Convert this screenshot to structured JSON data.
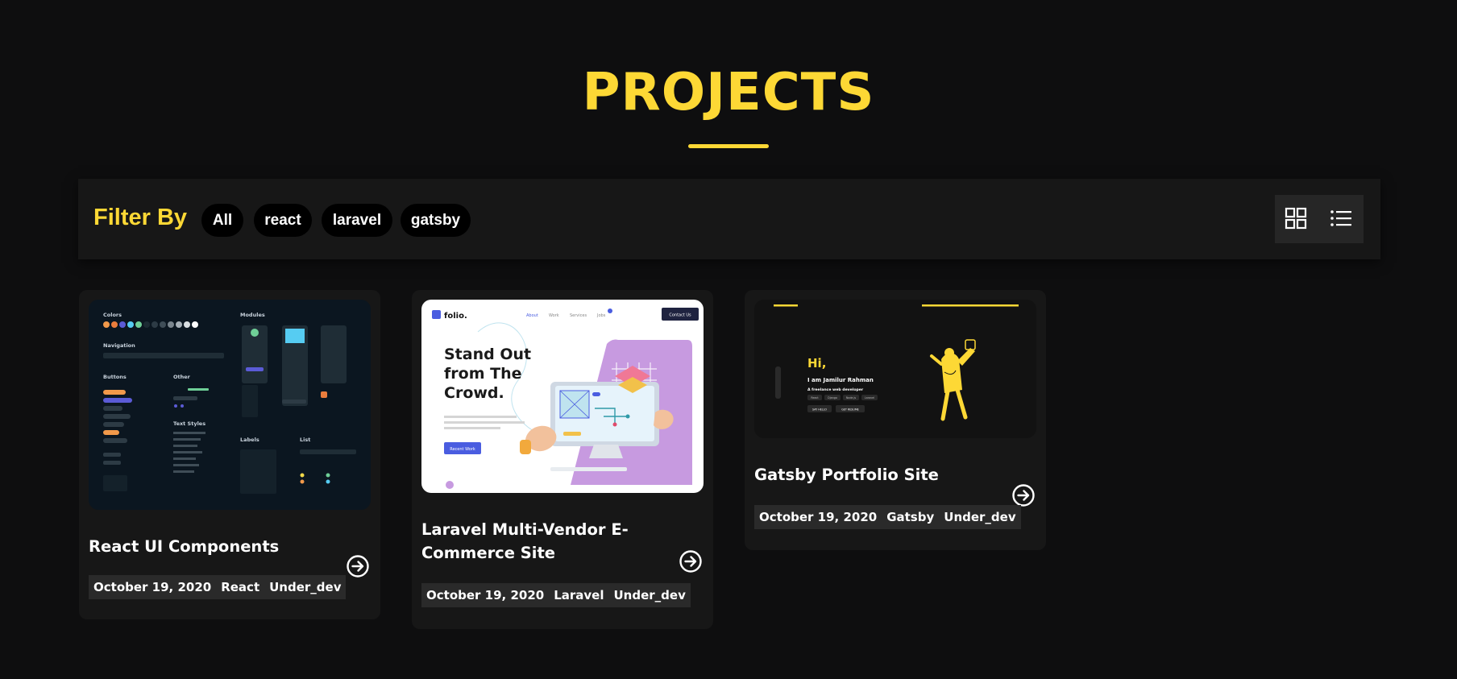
{
  "section": {
    "title": "PROJECTS"
  },
  "filter": {
    "label": "Filter By",
    "chips": [
      "All",
      "react",
      "laravel",
      "gatsby"
    ]
  },
  "view_toggle": {
    "grid_icon": "grid-icon",
    "list_icon": "list-icon"
  },
  "projects": [
    {
      "title": "React UI Components",
      "date": "October 19, 2020",
      "tech": "React",
      "status": "Under_dev",
      "thumb": {
        "colors_label": "Colors",
        "modules_label": "Modules",
        "navigation_label": "Navigation",
        "buttons_label": "Buttons",
        "other_label": "Other",
        "text_styles_label": "Text Styles",
        "labels_label": "Labels",
        "list_label": "List"
      }
    },
    {
      "title": "Laravel Multi-Vendor E-Commerce Site",
      "date": "October 19, 2020",
      "tech": "Laravel",
      "status": "Under_dev",
      "thumb": {
        "brand": "folio.",
        "nav": [
          "About",
          "Work",
          "Services",
          "Jobs"
        ],
        "cta": "Contact Us",
        "headline_1": "Stand Out",
        "headline_2": "from The",
        "headline_3": "Crowd.",
        "button": "Recent Work"
      }
    },
    {
      "title": "Gatsby Portfolio Site",
      "date": "October 19, 2020",
      "tech": "Gatsby",
      "status": "Under_dev",
      "thumb": {
        "greeting": "Hi,",
        "name_line": "I am Jamilur Rahman",
        "role_line": "A freelance web developer",
        "tags": [
          "React",
          "Django",
          "Node.js",
          "Laravel"
        ],
        "btn_1": "SAY HELLO",
        "btn_2": "GET RESUME"
      }
    }
  ],
  "colors": {
    "accent": "#fdd835",
    "background": "#0e0e0f",
    "card": "#171717"
  }
}
